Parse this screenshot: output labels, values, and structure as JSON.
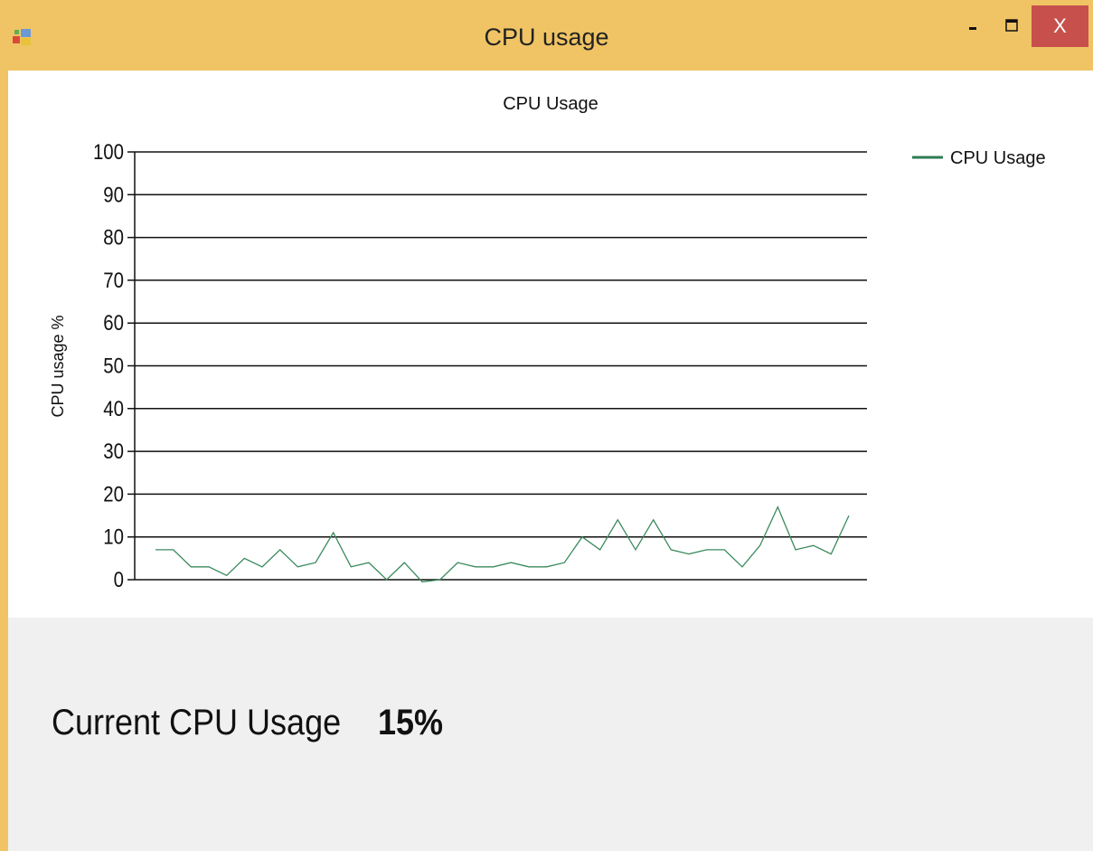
{
  "window": {
    "title": "CPU usage",
    "minimize_icon": "minimize-icon",
    "maximize_icon": "maximize-icon",
    "close_label": "X",
    "app_icon": "winforms-app-icon",
    "title_bar_color": "#f0c464",
    "close_color": "#c7504c"
  },
  "chart_data": {
    "type": "line",
    "title": "CPU Usage",
    "ylabel": "CPU usage %",
    "xlabel": "",
    "ylim": [
      0,
      100
    ],
    "yticks": [
      "0",
      "10",
      "20",
      "30",
      "40",
      "50",
      "60",
      "70",
      "80",
      "90",
      "100"
    ],
    "grid": "horizontal",
    "legend_position": "top-right",
    "series": [
      {
        "name": "CPU Usage",
        "color": "#3a8a5e",
        "values": [
          7,
          7,
          3,
          3,
          1,
          5,
          3,
          7,
          3,
          4,
          11,
          3,
          4,
          0,
          4,
          -0.5,
          0,
          4,
          3,
          3,
          4,
          3,
          3,
          4,
          10,
          7,
          14,
          7,
          14,
          7,
          6,
          7,
          7,
          3,
          8,
          17,
          7,
          8,
          6,
          15
        ]
      }
    ]
  },
  "status": {
    "label": "Current CPU Usage",
    "value": "15%"
  }
}
